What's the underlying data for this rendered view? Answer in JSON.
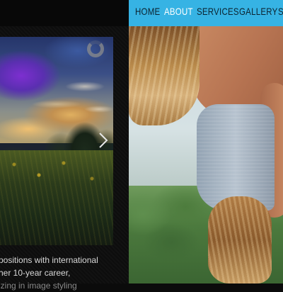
{
  "nav": {
    "items": [
      {
        "label": "HOME",
        "active": false
      },
      {
        "label": "ABOUT",
        "active": true
      },
      {
        "label": "SERVICES",
        "active": false
      },
      {
        "label": "GALLERY",
        "active": false
      },
      {
        "label": "S",
        "active": false
      }
    ],
    "bar_color": "#36b3e4",
    "active_color": "#ffffff"
  },
  "slideshow": {
    "loading_icon": "loading-spinner-icon",
    "next_icon": "chevron-right-icon"
  },
  "about": {
    "lines": [
      "positions with international",
      "her 10-year career,",
      "izing in image styling"
    ]
  },
  "colors": {
    "page_background": "#0b0b0b",
    "text": "#d8d8d8"
  }
}
